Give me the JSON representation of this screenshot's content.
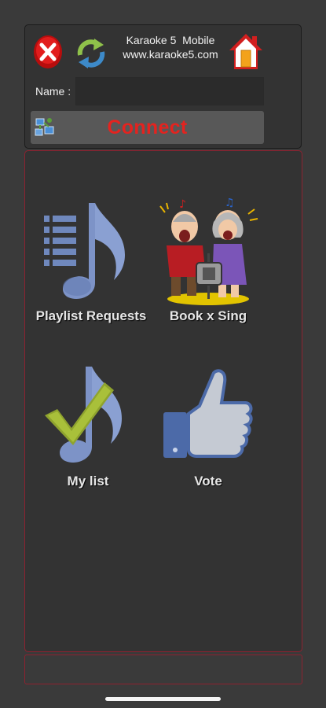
{
  "header": {
    "title": "Karaoke 5  Mobile",
    "website": "www.karaoke5.com",
    "name_label": "Name :",
    "name_value": "",
    "connect_label": "Connect"
  },
  "icons": {
    "close": "close-icon",
    "refresh": "refresh-icon",
    "home": "home-icon",
    "connect": "network-icon"
  },
  "tiles": [
    {
      "label": "Playlist Requests",
      "icon": "playlist-music-icon"
    },
    {
      "label": "Book x Sing",
      "icon": "singing-couple-icon"
    },
    {
      "label": "My list",
      "icon": "music-check-icon"
    },
    {
      "label": "Vote",
      "icon": "thumbs-up-icon"
    }
  ],
  "colors": {
    "background": "#3a3a3a",
    "connect_text": "#e4231f",
    "panel_border": "#8e2230",
    "note_blue": "#7d93c7"
  }
}
